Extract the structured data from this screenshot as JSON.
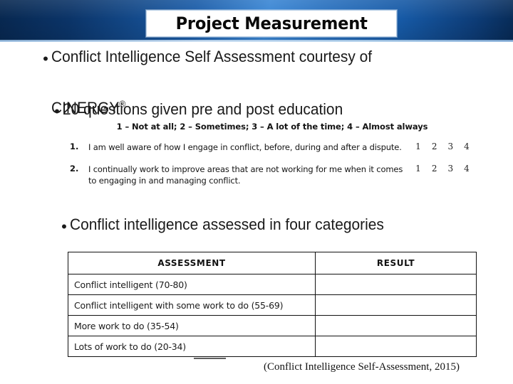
{
  "header": {
    "title": "Project Measurement",
    "gradient_start": "#07274f",
    "gradient_mid": "#3a86d4",
    "gradient_end": "#072a55",
    "title_box_bg": "#ffffff"
  },
  "bullets": [
    {
      "marker": "•",
      "text": "Conflict Intelligence Self Assessment courtesy of"
    },
    {
      "marker": "",
      "text": "CINERGY",
      "superscript": "®"
    },
    {
      "marker": "•",
      "text": "20 questions given pre and post education"
    },
    {
      "marker": "•",
      "text": "Conflict intelligence assessed in four categories"
    }
  ],
  "bullet_lines": {
    "line1": "Conflict Intelligence Self Assessment courtesy of",
    "line2_brand": "CINERGY",
    "line2_mark": "®",
    "line3": "20 questions given pre and post education",
    "line4": "Conflict intelligence assessed in four categories"
  },
  "assessment_snippet": {
    "legend": "1 – Not at all; 2 – Sometimes; 3 – A lot of the time; 4 – Almost always",
    "scale_values": [
      "1",
      "2",
      "3",
      "4"
    ],
    "questions": [
      {
        "number": "1.",
        "text": "I am well aware of how I engage in conflict, before, during and after a dispute.",
        "scale": [
          "1",
          "2",
          "3",
          "4"
        ]
      },
      {
        "number": "2.",
        "text": "I continually work to improve areas that are not working for me when it comes to engaging in and managing conflict.",
        "scale": [
          "1",
          "2",
          "3",
          "4"
        ]
      }
    ]
  },
  "assessment_table": {
    "headers": [
      "ASSESSMENT",
      "RESULT"
    ],
    "rows": [
      {
        "assessment": "Conflict intelligent (70-80)",
        "result": ""
      },
      {
        "assessment": "Conflict intelligent with some work to do (55-69)",
        "result": ""
      },
      {
        "assessment": "More work to do (35-54)",
        "result": ""
      },
      {
        "assessment": "Lots of work to do (20-34)",
        "result": ""
      }
    ]
  },
  "citation": "(Conflict Intelligence Self-Assessment, 2015)"
}
